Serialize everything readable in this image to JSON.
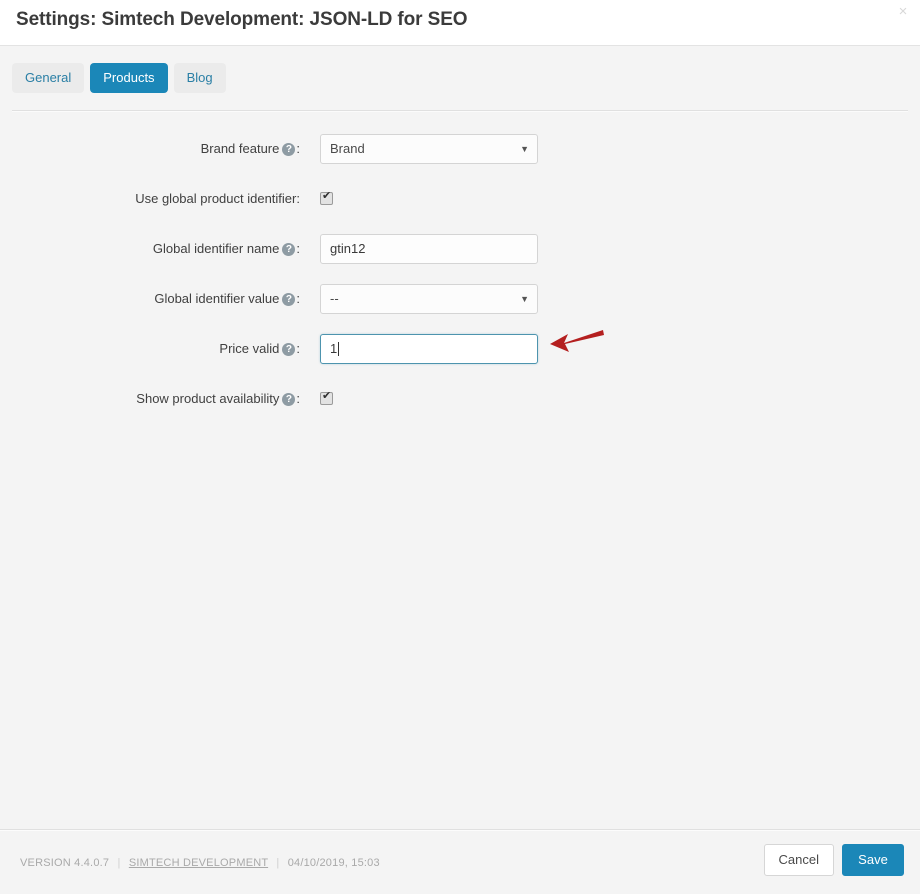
{
  "header": {
    "title": "Settings: Simtech Development: JSON-LD for SEO",
    "close_icon": "×"
  },
  "tabs": [
    {
      "label": "General",
      "active": false
    },
    {
      "label": "Products",
      "active": true
    },
    {
      "label": "Blog",
      "active": false
    }
  ],
  "form": {
    "help_icon": "?",
    "check_icon": "✔",
    "chevron_icon": "▼",
    "rows": [
      {
        "label": "Brand feature",
        "has_help": true,
        "colon": ":",
        "type": "select",
        "value": "Brand"
      },
      {
        "label": "Use global product identifier",
        "has_help": false,
        "colon": ":",
        "type": "checkbox",
        "value": "checked"
      },
      {
        "label": "Global identifier name",
        "has_help": true,
        "colon": ":",
        "type": "text",
        "value": "gtin12",
        "placeholder": ""
      },
      {
        "label": "Global identifier value",
        "has_help": true,
        "colon": ":",
        "type": "select",
        "value": "--"
      },
      {
        "label": "Price valid",
        "has_help": true,
        "colon": ":",
        "type": "text-focused",
        "value": "1",
        "placeholder": "",
        "annotation": "red-arrow"
      },
      {
        "label": "Show product availability",
        "has_help": true,
        "colon": ":",
        "type": "checkbox",
        "value": "checked"
      }
    ]
  },
  "footer": {
    "version": "VERSION 4.4.0.7",
    "separator": "|",
    "company": "SIMTECH DEVELOPMENT",
    "timestamp": "04/10/2019, 15:03",
    "cancel_label": "Cancel",
    "save_label": "Save"
  },
  "colors": {
    "accent": "#1b87b8",
    "tab_link": "#2a7fa5",
    "page_bg": "#f4f4f4",
    "focus_border": "#4d94ae",
    "arrow_red": "#b41f1f"
  }
}
